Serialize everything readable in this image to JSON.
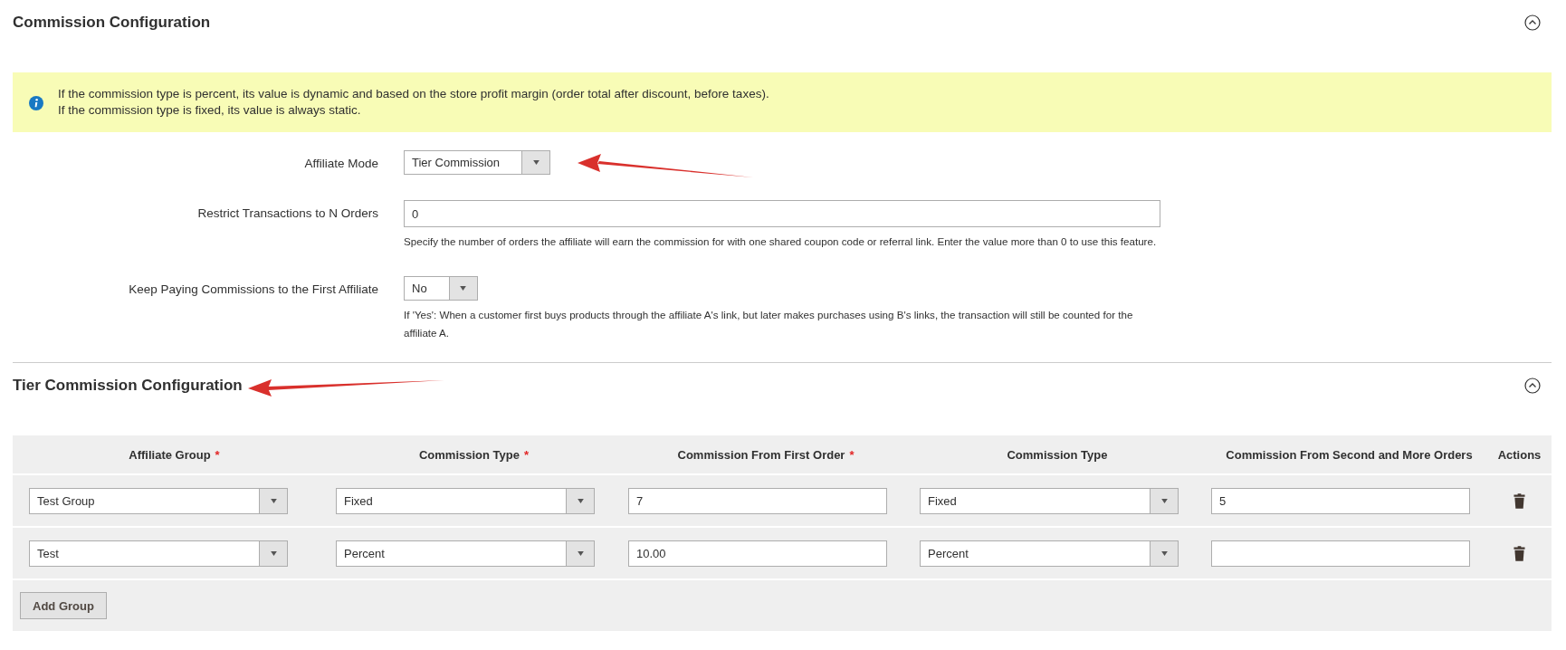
{
  "commission_configuration": {
    "title": "Commission Configuration",
    "expanded": true,
    "notice": [
      "If the commission type is percent, its value is dynamic and based on the store profit margin (order total after discount, before taxes).",
      "If the commission type is fixed, its value is always static."
    ],
    "fields": [
      {
        "kind": "select",
        "label": "Affiliate Mode",
        "value": "Tier Commission"
      },
      {
        "kind": "input",
        "label": "Restrict Transactions to N Orders",
        "value": "0",
        "note": "Specify the number of orders the affiliate will earn the commission for with one shared coupon code or referral link. Enter the value more than 0 to use this feature."
      },
      {
        "kind": "select",
        "label": "Keep Paying Commissions to the First Affiliate",
        "value": "No",
        "note": "If 'Yes': When a customer first buys products through the affiliate A's link, but later makes purchases using B's links, the transaction will still be counted for the affiliate A."
      }
    ]
  },
  "tier_commission_configuration": {
    "title": "Tier Commission Configuration",
    "expanded": true,
    "table": {
      "columns": [
        {
          "label": "Affiliate Group",
          "mark": "*"
        },
        {
          "label": "Commission Type",
          "mark": "*"
        },
        {
          "label": "Commission From First Order",
          "mark": "*"
        },
        {
          "label": "Commission Type"
        },
        {
          "label": "Commission From Second and More Orders"
        },
        {
          "label": "Actions"
        }
      ],
      "rows": [
        {
          "cells": [
            {
              "kind": "select",
              "value": "Test Group"
            },
            {
              "kind": "select",
              "value": "Fixed"
            },
            {
              "kind": "input",
              "value": "7"
            },
            {
              "kind": "select",
              "value": "Fixed"
            },
            {
              "kind": "input",
              "value": "5"
            },
            {
              "kind": "delete"
            }
          ]
        },
        {
          "cells": [
            {
              "kind": "select",
              "value": "Test"
            },
            {
              "kind": "select",
              "value": "Percent"
            },
            {
              "kind": "input",
              "value": "10.00"
            },
            {
              "kind": "select",
              "value": "Percent"
            },
            {
              "kind": "input"
            },
            {
              "kind": "delete"
            }
          ]
        }
      ]
    },
    "add_button": "Add Group"
  }
}
